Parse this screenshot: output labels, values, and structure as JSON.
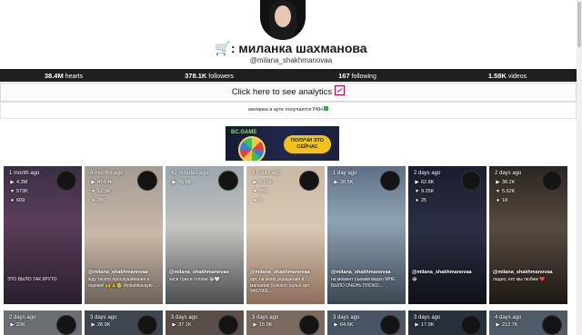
{
  "profile": {
    "name": "🛒: миланка шахманова",
    "handle": "@milana_shakhmanovaa"
  },
  "stats": [
    {
      "value": "38.4M",
      "label": "hearts"
    },
    {
      "value": "378.1K",
      "label": "followers"
    },
    {
      "value": "167",
      "label": "following"
    },
    {
      "value": "1.58K",
      "label": "videos"
    }
  ],
  "analytics_label": "Click here to see analytics",
  "notice_text": "миланка в ауте получается РКН",
  "banner": {
    "brand": "BC.GAME",
    "cta": "ПОЛУЧИ ЭТО СЕЙЧАС"
  },
  "videos": [
    {
      "date": "1 month ago",
      "views": "4.3M",
      "likes": "573K",
      "comments": "609",
      "account": "",
      "caption": "ЭТО БЫЛО ТАК КРУТО"
    },
    {
      "date": "4 months ago",
      "views": "474.4K",
      "likes": "12.3K",
      "comments": "380",
      "account": "@milana_shakhmanovaa",
      "caption": "жду твоего прослушивания и оценки! 🙌🙏🥺 #milankavayte ..."
    },
    {
      "date": "42 minutes ago",
      "views": "45.8K",
      "likes": "",
      "comments": "",
      "account": "@milana_shakhmanovaa",
      "caption": "засв трек в голове 😂🤍"
    },
    {
      "date": "3 hours ago",
      "views": "5.71K",
      "likes": "559",
      "comments": "9",
      "account": "@milana_shakhmanovaa",
      "caption": "арт. на моих украшения в магазине Sokolov: колье арт. 94070б6..."
    },
    {
      "date": "1 day ago",
      "views": "28.5K",
      "likes": "",
      "comments": "",
      "account": "@milana_shakhmanovaa",
      "caption": "на момент съемки видео МНЕ БЫЛО ОЧЕНЬ ПЛОХО..."
    },
    {
      "date": "2 days ago",
      "views": "62.8K",
      "likes": "9.25K",
      "comments": "25",
      "account": "@milana_shakhmanovaa",
      "caption": "😂"
    },
    {
      "date": "2 days ago",
      "views": "38.2K",
      "likes": "5.62K",
      "comments": "18",
      "account": "@milana_shakhmanovaa",
      "caption": "ладно, его мы любим ❤️"
    }
  ],
  "videos_row2": [
    {
      "date": "2 days ago",
      "views": "23K"
    },
    {
      "date": "3 days ago",
      "views": "28.9K"
    },
    {
      "date": "3 days ago",
      "views": "37.1K"
    },
    {
      "date": "3 days ago",
      "views": "15.9K"
    },
    {
      "date": "3 days ago",
      "views": "64.6K"
    },
    {
      "date": "3 days ago",
      "views": "17.9K"
    },
    {
      "date": "4 days ago",
      "views": "212.7K"
    }
  ]
}
